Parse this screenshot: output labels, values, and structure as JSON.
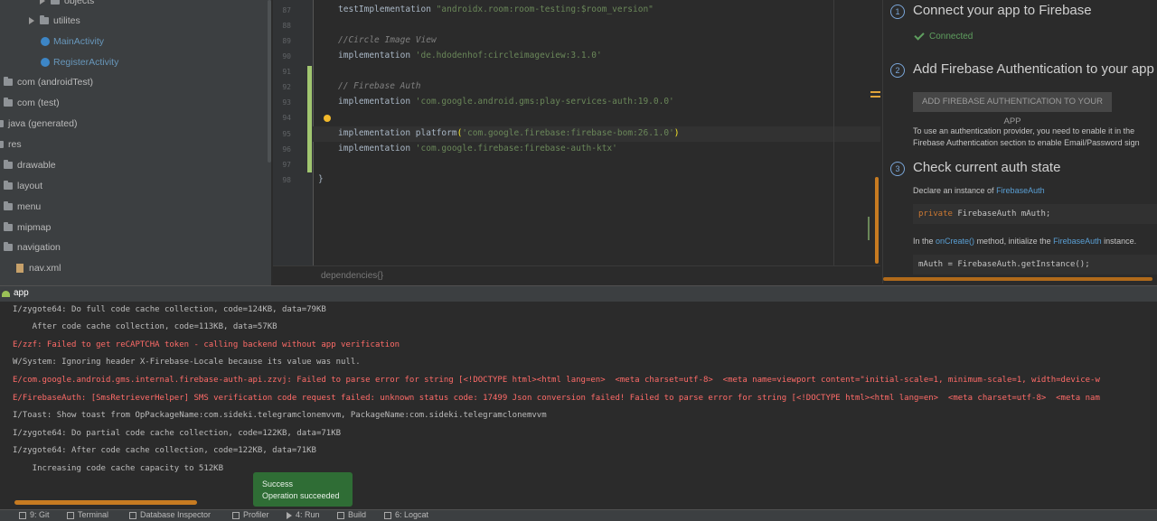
{
  "project_tree": {
    "items": [
      {
        "label": "objects",
        "kind": "folder",
        "expand": true
      },
      {
        "label": "utilites",
        "kind": "folder",
        "expand": true
      },
      {
        "label": "MainActivity",
        "kind": "class"
      },
      {
        "label": "RegisterActivity",
        "kind": "class"
      },
      {
        "label": "com (androidTest)",
        "kind": "folder"
      },
      {
        "label": "com (test)",
        "kind": "folder"
      },
      {
        "label": "java (generated)",
        "kind": "folder"
      },
      {
        "label": "res",
        "kind": "folder"
      },
      {
        "label": "drawable",
        "kind": "folder"
      },
      {
        "label": "layout",
        "kind": "folder"
      },
      {
        "label": "menu",
        "kind": "folder"
      },
      {
        "label": "mipmap",
        "kind": "folder"
      },
      {
        "label": "navigation",
        "kind": "folder"
      },
      {
        "label": "nav.xml",
        "kind": "xml"
      }
    ]
  },
  "editor": {
    "line_numbers": [
      "87",
      "88",
      "89",
      "90",
      "91",
      "92",
      "93",
      "94",
      "95",
      "96",
      "97",
      "98"
    ],
    "lines": {
      "l87a": "testImplementation ",
      "l87b": "\"androidx.room:room-testing:$room_version\"",
      "l89": "//Circle Image View",
      "l90a": "implementation ",
      "l90b": "'de.hdodenhof:circleimageview:3.1.0'",
      "l92": "// Firebase Auth",
      "l93a": "implementation ",
      "l93b": "'com.google.android.gms:play-services-auth:19.0.0'",
      "l95a": "implementation ",
      "l95b": "platform",
      "l95c": "(",
      "l95d": "'com.google.firebase:firebase-bom:26.1.0'",
      "l95e": ")",
      "l96a": "implementation ",
      "l96b": "'com.google.firebase:firebase-auth-ktx'",
      "l98": "}"
    },
    "breadcrumb": "dependencies{}"
  },
  "assistant": {
    "step1": {
      "num": "1",
      "title": "Connect your app to Firebase",
      "status": "Connected"
    },
    "step2": {
      "num": "2",
      "title": "Add Firebase Authentication to your app",
      "button": "ADD FIREBASE AUTHENTICATION TO YOUR APP",
      "text1": "To use an authentication provider, you need to enable it in the",
      "text2": "Firebase Authentication section to enable Email/Password sign"
    },
    "step3": {
      "num": "3",
      "title": "Check current auth state",
      "declare_a": "Declare an instance of ",
      "declare_link": "FirebaseAuth",
      "code1_kw": "private",
      "code1_rest": " FirebaseAuth mAuth;",
      "oncreate_a": "In the ",
      "oncreate_link": "onCreate()",
      "oncreate_b": " method, initialize the ",
      "oncreate_link2": "FirebaseAuth",
      "oncreate_c": " instance.",
      "code2": "mAuth = FirebaseAuth.getInstance();"
    }
  },
  "run": {
    "tab_label": "app",
    "log": [
      {
        "text": "I/zygote64: Do full code cache collection, code=124KB, data=79KB",
        "level": "info"
      },
      {
        "text": "    After code cache collection, code=113KB, data=57KB",
        "level": "info"
      },
      {
        "text": "E/zzf: Failed to get reCAPTCHA token - calling backend without app verification",
        "level": "error"
      },
      {
        "text": "W/System: Ignoring header X-Firebase-Locale because its value was null.",
        "level": "info"
      },
      {
        "text": "E/com.google.android.gms.internal.firebase-auth-api.zzvj: Failed to parse error for string [<!DOCTYPE html><html lang=en>  <meta charset=utf-8>  <meta name=viewport content=\"initial-scale=1, minimum-scale=1, width=device-w",
        "level": "error"
      },
      {
        "text": "E/FirebaseAuth: [SmsRetrieverHelper] SMS verification code request failed: unknown status code: 17499 Json conversion failed! Failed to parse error for string [<!DOCTYPE html><html lang=en>  <meta charset=utf-8>  <meta nam",
        "level": "error"
      },
      {
        "text": "I/Toast: Show toast from OpPackageName:com.sideki.telegramclonemvvm, PackageName:com.sideki.telegramclonemvvm",
        "level": "info"
      },
      {
        "text": "I/zygote64: Do partial code cache collection, code=122KB, data=71KB",
        "level": "info"
      },
      {
        "text": "I/zygote64: After code cache collection, code=122KB, data=71KB",
        "level": "info"
      },
      {
        "text": "    Increasing code cache capacity to 512KB",
        "level": "info"
      }
    ],
    "toast": {
      "title": "Success",
      "message": "Operation succeeded"
    }
  },
  "toolbar": {
    "git": "9: Git",
    "terminal": "Terminal",
    "db": "Database Inspector",
    "profiler": "Profiler",
    "run": "4: Run",
    "build": "Build",
    "logcat": "6: Logcat"
  }
}
